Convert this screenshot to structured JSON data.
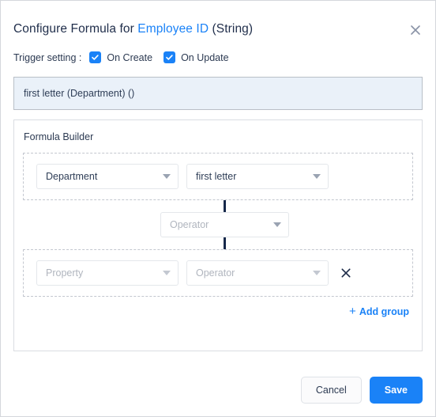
{
  "dialog": {
    "title_prefix": "Configure Formula for",
    "title_field": "Employee ID",
    "title_suffix": "(String)",
    "close_label": "✕"
  },
  "trigger": {
    "label": "Trigger setting :",
    "options": [
      {
        "label": "On Create",
        "checked": true
      },
      {
        "label": "On Update",
        "checked": true
      }
    ]
  },
  "formula_preview": {
    "text": "first letter (Department) ()"
  },
  "builder": {
    "title": "Formula Builder",
    "groups": [
      {
        "property": {
          "value": "Department",
          "placeholder": "Property",
          "filled": true
        },
        "operator": {
          "value": "first letter",
          "placeholder": "Operator",
          "filled": true
        },
        "removable": false
      },
      {
        "property": {
          "value": "",
          "placeholder": "Property",
          "filled": false
        },
        "operator": {
          "value": "",
          "placeholder": "Operator",
          "filled": false
        },
        "removable": true
      }
    ],
    "join_operator": {
      "value": "",
      "placeholder": "Operator",
      "filled": false
    },
    "add_group_label": "Add group",
    "add_group_plus": "+",
    "remove_label": "✕"
  },
  "footer": {
    "cancel_label": "Cancel",
    "save_label": "Save"
  },
  "colors": {
    "accent": "#1a82f7",
    "text_dark": "#2c3a52",
    "placeholder": "#b0b5be",
    "formula_bg": "#eaf1f9",
    "connector": "#16284a"
  }
}
